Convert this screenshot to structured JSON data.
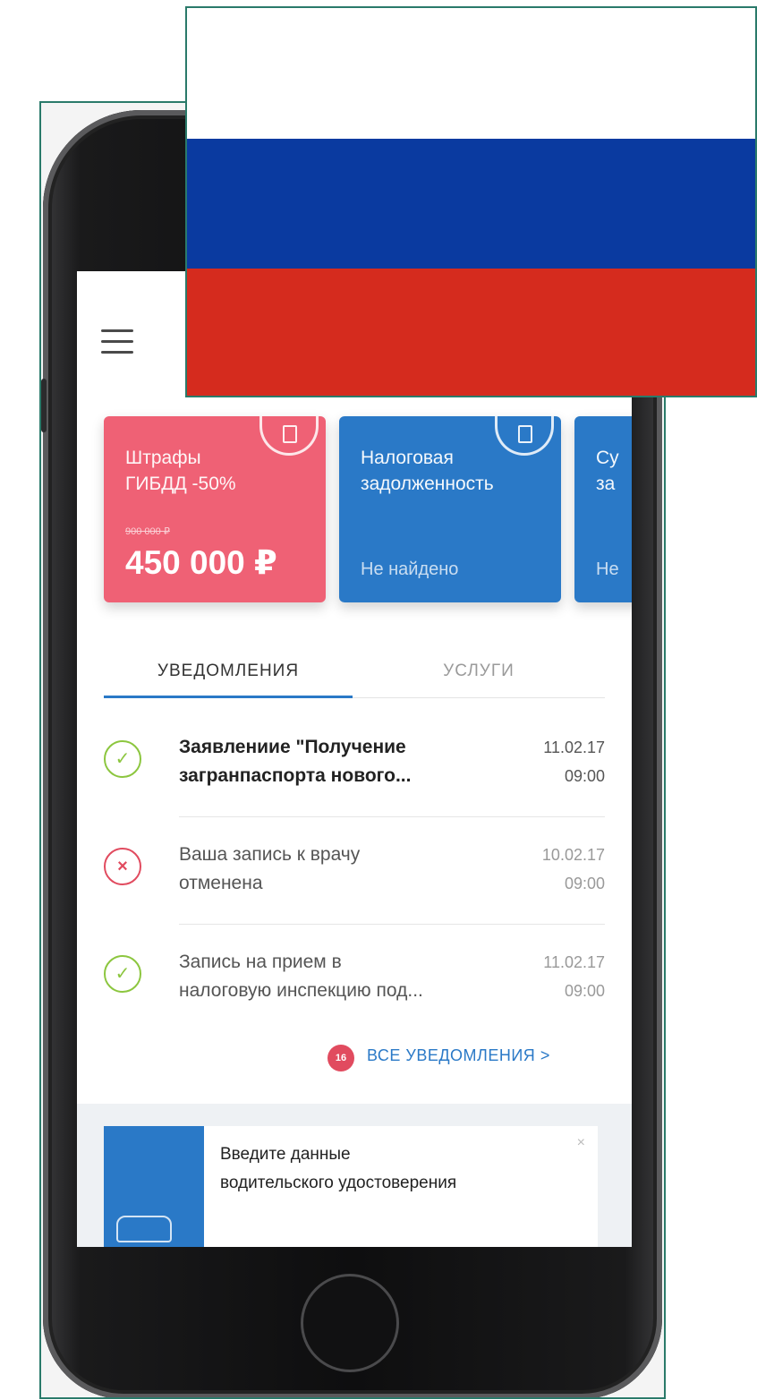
{
  "flag": {
    "colors": {
      "white": "#ffffff",
      "blue": "#0a3aa0",
      "red": "#d52b1e"
    }
  },
  "cards": [
    {
      "title_line1": "Штрафы",
      "title_line2": "ГИБДД -50%",
      "old_amount": "900 000 ₽",
      "amount": "450 000 ₽",
      "icon": "document-icon"
    },
    {
      "title_line1": "Налоговая",
      "title_line2": "задолженность",
      "status": "Не найдено",
      "icon": "tax-document-icon"
    },
    {
      "title_line1": "Су",
      "title_line2": "за",
      "status": "Не"
    }
  ],
  "tabs": {
    "notifications": "УВЕДОМЛЕНИЯ",
    "services": "УСЛУГИ"
  },
  "notifications": [
    {
      "line1": "Заявлениие \"Получение",
      "line2": "загранпаспорта нового...",
      "date": "11.02.17",
      "time": "09:00",
      "status_icon": "check"
    },
    {
      "line1": "Ваша запись к врачу",
      "line2": "отменена",
      "date": "10.02.17",
      "time": "09:00",
      "status_icon": "cross"
    },
    {
      "line1": "Запись на прием в",
      "line2": "налоговую инспекцию под...",
      "date": "11.02.17",
      "time": "09:00",
      "status_icon": "check"
    }
  ],
  "all_notifications": {
    "badge": "16",
    "label": "ВСЕ УВЕДОМЛЕНИЯ",
    "chevron": ">"
  },
  "promo": {
    "line1": "Введите данные",
    "line2": "водительского удостоверения",
    "close": "×"
  },
  "icons": {
    "check": "✓",
    "cross": "×"
  }
}
